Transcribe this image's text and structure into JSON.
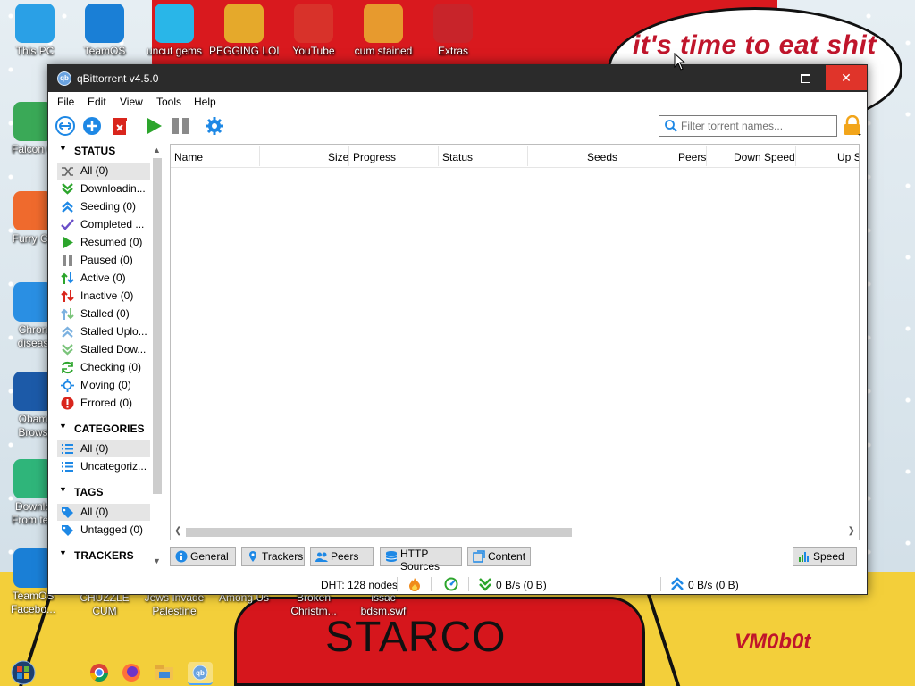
{
  "wallpaper": {
    "bubble_text": "it's time to eat shit",
    "shirt_text": "STARCO",
    "signature": "VM0b0t"
  },
  "desktop_icons": [
    {
      "label": "This PC",
      "icon": "computer-icon",
      "color": "#2aa0e6"
    },
    {
      "label": "TeamOS",
      "icon": "gear-icon",
      "color": "#1a7fd6"
    },
    {
      "label": "uncut gems",
      "icon": "diamond-icon",
      "color": "#29b6e8"
    },
    {
      "label": "PEGGING LOL",
      "icon": "p-logo-icon",
      "color": "#e5a92b"
    },
    {
      "label": "YouTube",
      "icon": "angry-bird-icon",
      "color": "#d8322a"
    },
    {
      "label": "cum stained",
      "icon": "santa-icon",
      "color": "#e79a2e"
    },
    {
      "label": "Extras",
      "icon": "gift-icon",
      "color": "#c8242a"
    },
    {
      "label": "Falcon C",
      "icon": "recycle-icon",
      "color": "#3aa957"
    },
    {
      "label": "Furry Co",
      "icon": "firefox-icon",
      "color": "#ef6a2d"
    },
    {
      "label": "Chron",
      "label2": "diseas",
      "icon": "chrome-icon",
      "color": "#2a8fe3"
    },
    {
      "label": "Obam",
      "label2": "Brows",
      "icon": "obama-logo-icon",
      "color": "#1c5aa8"
    },
    {
      "label": "Downlo",
      "label2": "From tea",
      "icon": "green-tile-icon",
      "color": "#2fb57a"
    },
    {
      "label": "TeamOS",
      "label2": "Facebo...",
      "icon": "gear-icon",
      "color": "#1a7fd6"
    },
    {
      "label": "CHUZZLE",
      "label2": "CUM",
      "icon": "none",
      "color": "#000000"
    },
    {
      "label": "Jews Invade",
      "label2": "Palestine",
      "icon": "none",
      "color": "#000000"
    },
    {
      "label": "Among Us",
      "icon": "none",
      "color": "#000000"
    },
    {
      "label": "Broken",
      "label2": "Christm...",
      "icon": "none",
      "color": "#000000"
    },
    {
      "label": "issac",
      "label2": "bdsm.swf",
      "icon": "none",
      "color": "#000000"
    }
  ],
  "window": {
    "title": "qBittorrent v4.5.0",
    "app_icon_text": "qb"
  },
  "menu": [
    "File",
    "Edit",
    "View",
    "Tools",
    "Help"
  ],
  "toolbar": {
    "buttons": [
      "add-link-icon",
      "add-torrent-icon",
      "delete-icon",
      "resume-icon",
      "pause-icon",
      "options-icon"
    ],
    "filter_placeholder": "Filter torrent names..."
  },
  "sidebar": {
    "status_header": "STATUS",
    "status_items": [
      {
        "label": "All (0)",
        "icon": "all-icon",
        "selected": true
      },
      {
        "label": "Downloadin...",
        "icon": "downloading-icon"
      },
      {
        "label": "Seeding (0)",
        "icon": "seeding-icon"
      },
      {
        "label": "Completed ...",
        "icon": "completed-icon"
      },
      {
        "label": "Resumed (0)",
        "icon": "resumed-icon"
      },
      {
        "label": "Paused (0)",
        "icon": "paused-icon"
      },
      {
        "label": "Active (0)",
        "icon": "active-icon"
      },
      {
        "label": "Inactive (0)",
        "icon": "inactive-icon"
      },
      {
        "label": "Stalled (0)",
        "icon": "stalled-icon"
      },
      {
        "label": "Stalled Uplo...",
        "icon": "stalled-upload-icon"
      },
      {
        "label": "Stalled Dow...",
        "icon": "stalled-download-icon"
      },
      {
        "label": "Checking (0)",
        "icon": "checking-icon"
      },
      {
        "label": "Moving (0)",
        "icon": "moving-icon"
      },
      {
        "label": "Errored (0)",
        "icon": "errored-icon"
      }
    ],
    "categories_header": "CATEGORIES",
    "category_items": [
      {
        "label": "All (0)",
        "icon": "list-icon",
        "selected": true
      },
      {
        "label": "Uncategoriz...",
        "icon": "list-icon"
      }
    ],
    "tags_header": "TAGS",
    "tag_items": [
      {
        "label": "All (0)",
        "icon": "tag-icon",
        "selected": true
      },
      {
        "label": "Untagged (0)",
        "icon": "tag-icon"
      }
    ],
    "trackers_header": "TRACKERS"
  },
  "list": {
    "columns": [
      "Name",
      "Size",
      "Progress",
      "Status",
      "Seeds",
      "Peers",
      "Down Speed",
      "Up S"
    ]
  },
  "tabs": [
    {
      "label": "General",
      "icon": "info-icon"
    },
    {
      "label": "Trackers",
      "icon": "pin-icon"
    },
    {
      "label": "Peers",
      "icon": "peers-icon"
    },
    {
      "label": "HTTP Sources",
      "icon": "server-icon"
    },
    {
      "label": "Content",
      "icon": "content-icon"
    }
  ],
  "speed_button": "Speed",
  "statusbar": {
    "dht": "DHT: 128 nodes",
    "down": "0 B/s (0 B)",
    "up": "0 B/s (0 B)"
  },
  "colors": {
    "titlebar": "#2b2b2b",
    "close": "#e0342a",
    "accent": "#1e88e5",
    "green": "#2ca52c",
    "red": "#d9251c"
  }
}
